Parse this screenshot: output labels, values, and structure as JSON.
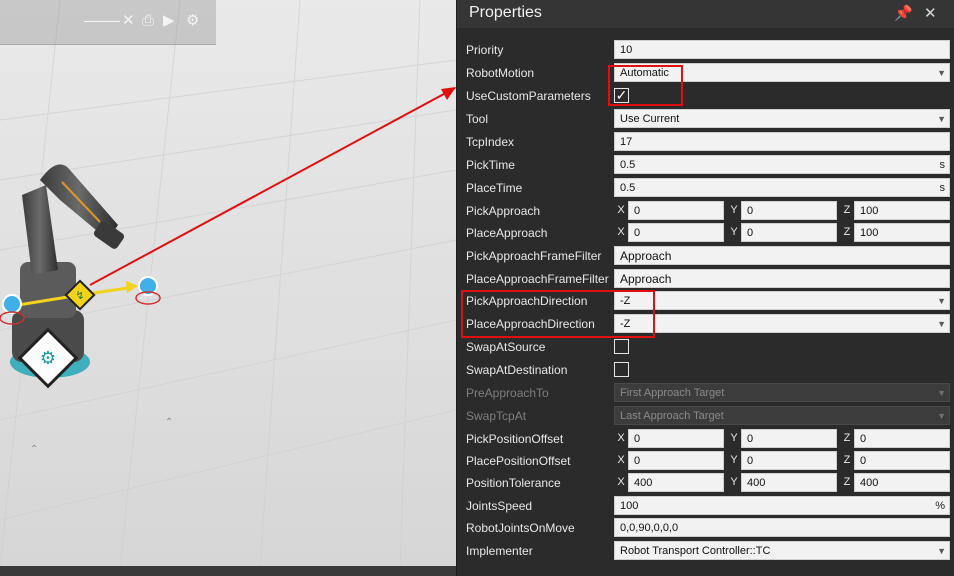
{
  "panel": {
    "title": "Properties",
    "pin_icon": "pin-icon",
    "close_icon": "close-icon"
  },
  "properties": {
    "priority": {
      "label": "Priority",
      "value": "10"
    },
    "robot_motion": {
      "label": "RobotMotion",
      "value": "Automatic"
    },
    "use_custom_parameters": {
      "label": "UseCustomParameters",
      "checked": true
    },
    "tool": {
      "label": "Tool",
      "value": "Use Current"
    },
    "tcp_index": {
      "label": "TcpIndex",
      "value": "17"
    },
    "pick_time": {
      "label": "PickTime",
      "value": "0.5",
      "unit": "s"
    },
    "place_time": {
      "label": "PlaceTime",
      "value": "0.5",
      "unit": "s"
    },
    "pick_approach": {
      "label": "PickApproach",
      "x": "0",
      "y": "0",
      "z": "100"
    },
    "place_approach": {
      "label": "PlaceApproach",
      "x": "0",
      "y": "0",
      "z": "100"
    },
    "pick_approach_frame_filter": {
      "label": "PickApproachFrameFilter",
      "value": "Approach"
    },
    "place_approach_frame_filter": {
      "label": "PlaceApproachFrameFilter",
      "value": "Approach"
    },
    "pick_approach_direction": {
      "label": "PickApproachDirection",
      "value": "-Z"
    },
    "place_approach_direction": {
      "label": "PlaceApproachDirection",
      "value": "-Z"
    },
    "swap_at_source": {
      "label": "SwapAtSource",
      "checked": false
    },
    "swap_at_destination": {
      "label": "SwapAtDestination",
      "checked": false
    },
    "pre_approach_to": {
      "label": "PreApproachTo",
      "value": "First Approach Target"
    },
    "swap_tcp_at": {
      "label": "SwapTcpAt",
      "value": "Last Approach Target"
    },
    "pick_position_offset": {
      "label": "PickPositionOffset",
      "x": "0",
      "y": "0",
      "z": "0"
    },
    "place_position_offset": {
      "label": "PlacePositionOffset",
      "x": "0",
      "y": "0",
      "z": "0"
    },
    "position_tolerance": {
      "label": "PositionTolerance",
      "x": "400",
      "y": "400",
      "z": "400"
    },
    "joints_speed": {
      "label": "JointsSpeed",
      "value": "100",
      "unit": "%"
    },
    "robot_joints_on_move": {
      "label": "RobotJointsOnMove",
      "value": "0,0,90,0,0,0"
    },
    "implementer": {
      "label": "Implementer",
      "value": "Robot Transport Controller::TC"
    }
  },
  "axes": {
    "x": "X",
    "y": "Y",
    "z": "Z"
  },
  "colors": {
    "annotation": "#e01010",
    "path": "#f2d21b",
    "target": "#3fb0ea"
  }
}
